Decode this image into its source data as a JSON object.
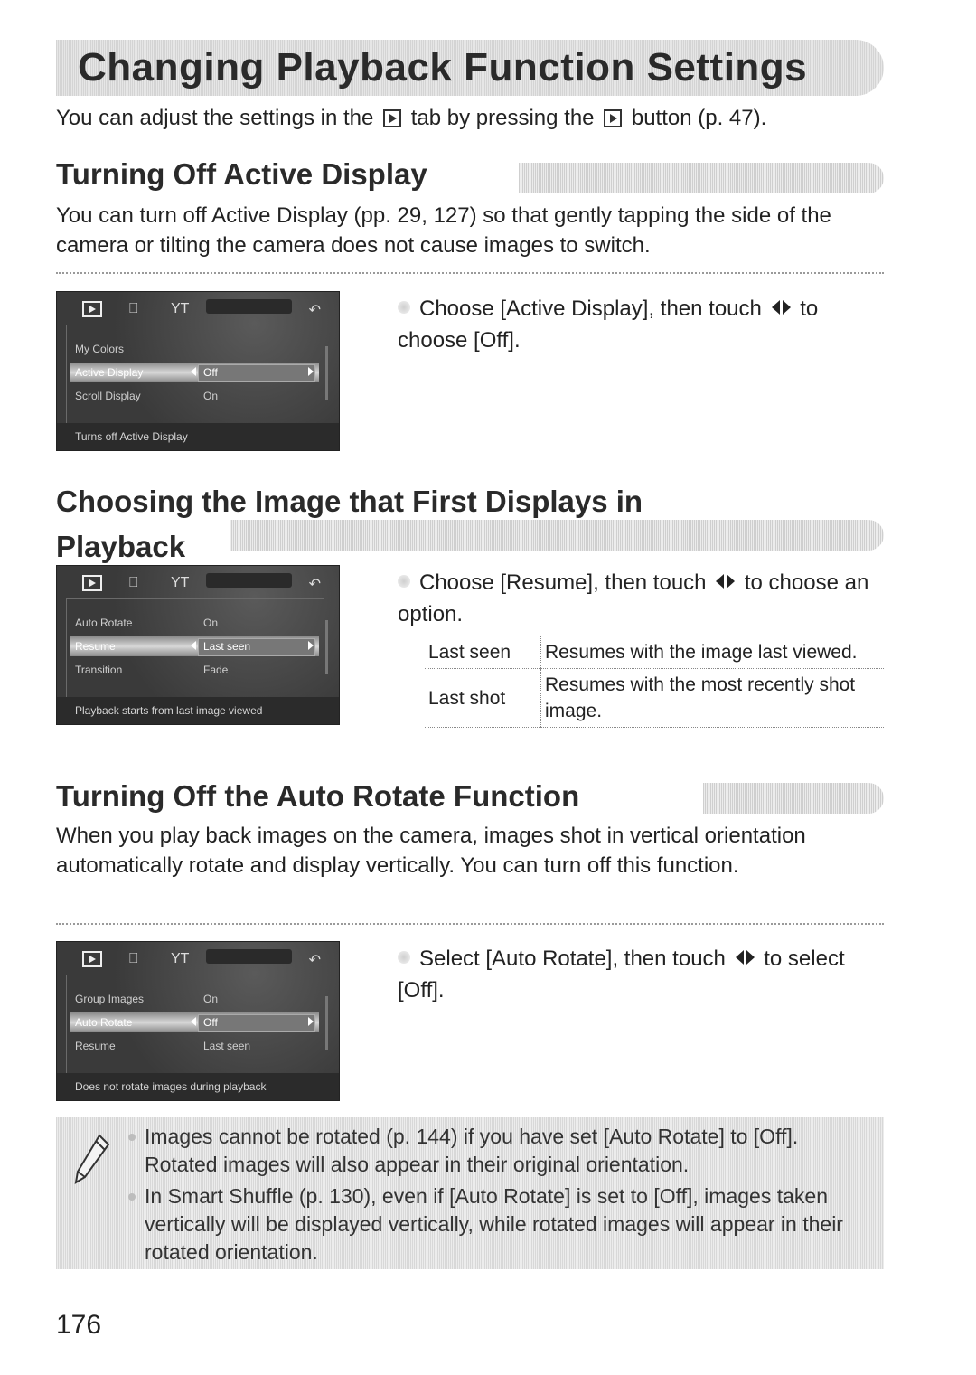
{
  "page_title": "Changing Playback Function Settings",
  "intro": {
    "part1": "You can adjust the settings in the",
    "part2": "tab by pressing the",
    "part3": "button (p. 47).",
    "icon": "playback-icon"
  },
  "sections": [
    {
      "heading": "Turning Off Active Display",
      "body": "You can turn off Active Display (pp. 29, 127) so that gently tapping the side of the camera or tilting the camera does not cause images to switch.",
      "step": {
        "before": "Choose [Active Display], then touch",
        "after": "to choose [Off]."
      },
      "screen": {
        "tabs": [
          "playback-tab",
          "print-tab",
          "tools-tab",
          "back"
        ],
        "rows": [
          {
            "label": "My Colors",
            "value": ""
          },
          {
            "label": "Active Display",
            "value": "Off",
            "selected": true
          },
          {
            "label": "Scroll Display",
            "value": "On"
          }
        ],
        "hint": "Turns off Active Display"
      }
    },
    {
      "heading_line1": "Choosing the Image that First Displays in",
      "heading_line2": "Playback",
      "step": {
        "before": "Choose [Resume], then touch",
        "after": "to choose an option."
      },
      "screen": {
        "rows": [
          {
            "label": "Auto Rotate",
            "value": "On"
          },
          {
            "label": "Resume",
            "value": "Last seen",
            "selected": true
          },
          {
            "label": "Transition",
            "value": "Fade"
          }
        ],
        "hint": "Playback starts from last image viewed"
      },
      "options": [
        {
          "option": "Last seen",
          "description": "Resumes with the image last viewed."
        },
        {
          "option": "Last shot",
          "description": "Resumes with the most recently shot image."
        }
      ]
    },
    {
      "heading": "Turning Off the Auto Rotate Function",
      "body": "When you play back images on the camera, images shot in vertical orientation automatically rotate and display vertically. You can turn off this function.",
      "step": {
        "before": "Select [Auto Rotate], then touch",
        "after": "to select [Off]."
      },
      "screen": {
        "rows": [
          {
            "label": "Group Images",
            "value": "On"
          },
          {
            "label": "Auto Rotate",
            "value": "Off",
            "selected": true
          },
          {
            "label": "Resume",
            "value": "Last seen"
          }
        ],
        "hint": "Does not rotate images during playback"
      }
    }
  ],
  "notes": [
    "Images cannot be rotated (p. 144) if you have set [Auto Rotate] to [Off]. Rotated images will also appear in their original orientation.",
    "In Smart Shuffle (p. 130), even if [Auto Rotate] is set to [Off], images taken vertically will be displayed vertically, while rotated images will appear in their rotated orientation."
  ],
  "page_number": "176"
}
